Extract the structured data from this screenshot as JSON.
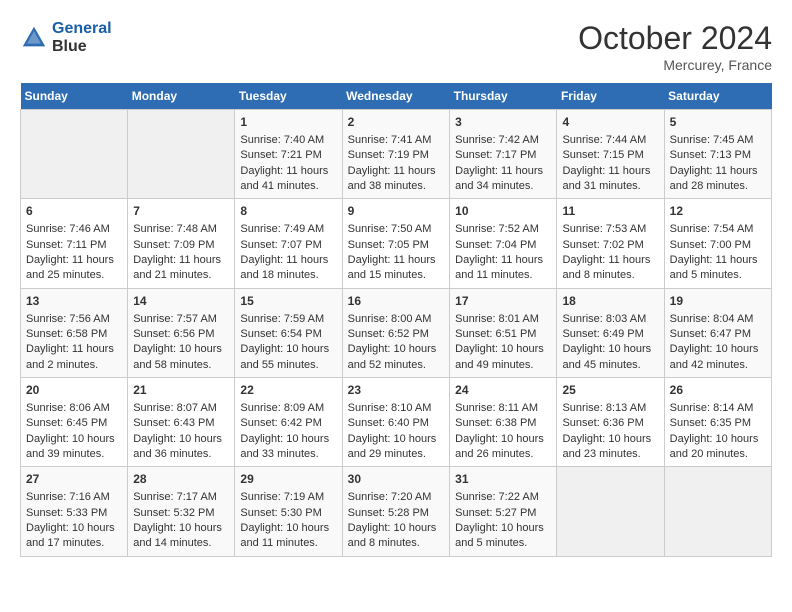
{
  "header": {
    "logo_line1": "General",
    "logo_line2": "Blue",
    "month": "October 2024",
    "location": "Mercurey, France"
  },
  "weekdays": [
    "Sunday",
    "Monday",
    "Tuesday",
    "Wednesday",
    "Thursday",
    "Friday",
    "Saturday"
  ],
  "weeks": [
    [
      {
        "day": "",
        "data": ""
      },
      {
        "day": "",
        "data": ""
      },
      {
        "day": "1",
        "data": "Sunrise: 7:40 AM\nSunset: 7:21 PM\nDaylight: 11 hours and 41 minutes."
      },
      {
        "day": "2",
        "data": "Sunrise: 7:41 AM\nSunset: 7:19 PM\nDaylight: 11 hours and 38 minutes."
      },
      {
        "day": "3",
        "data": "Sunrise: 7:42 AM\nSunset: 7:17 PM\nDaylight: 11 hours and 34 minutes."
      },
      {
        "day": "4",
        "data": "Sunrise: 7:44 AM\nSunset: 7:15 PM\nDaylight: 11 hours and 31 minutes."
      },
      {
        "day": "5",
        "data": "Sunrise: 7:45 AM\nSunset: 7:13 PM\nDaylight: 11 hours and 28 minutes."
      }
    ],
    [
      {
        "day": "6",
        "data": "Sunrise: 7:46 AM\nSunset: 7:11 PM\nDaylight: 11 hours and 25 minutes."
      },
      {
        "day": "7",
        "data": "Sunrise: 7:48 AM\nSunset: 7:09 PM\nDaylight: 11 hours and 21 minutes."
      },
      {
        "day": "8",
        "data": "Sunrise: 7:49 AM\nSunset: 7:07 PM\nDaylight: 11 hours and 18 minutes."
      },
      {
        "day": "9",
        "data": "Sunrise: 7:50 AM\nSunset: 7:05 PM\nDaylight: 11 hours and 15 minutes."
      },
      {
        "day": "10",
        "data": "Sunrise: 7:52 AM\nSunset: 7:04 PM\nDaylight: 11 hours and 11 minutes."
      },
      {
        "day": "11",
        "data": "Sunrise: 7:53 AM\nSunset: 7:02 PM\nDaylight: 11 hours and 8 minutes."
      },
      {
        "day": "12",
        "data": "Sunrise: 7:54 AM\nSunset: 7:00 PM\nDaylight: 11 hours and 5 minutes."
      }
    ],
    [
      {
        "day": "13",
        "data": "Sunrise: 7:56 AM\nSunset: 6:58 PM\nDaylight: 11 hours and 2 minutes."
      },
      {
        "day": "14",
        "data": "Sunrise: 7:57 AM\nSunset: 6:56 PM\nDaylight: 10 hours and 58 minutes."
      },
      {
        "day": "15",
        "data": "Sunrise: 7:59 AM\nSunset: 6:54 PM\nDaylight: 10 hours and 55 minutes."
      },
      {
        "day": "16",
        "data": "Sunrise: 8:00 AM\nSunset: 6:52 PM\nDaylight: 10 hours and 52 minutes."
      },
      {
        "day": "17",
        "data": "Sunrise: 8:01 AM\nSunset: 6:51 PM\nDaylight: 10 hours and 49 minutes."
      },
      {
        "day": "18",
        "data": "Sunrise: 8:03 AM\nSunset: 6:49 PM\nDaylight: 10 hours and 45 minutes."
      },
      {
        "day": "19",
        "data": "Sunrise: 8:04 AM\nSunset: 6:47 PM\nDaylight: 10 hours and 42 minutes."
      }
    ],
    [
      {
        "day": "20",
        "data": "Sunrise: 8:06 AM\nSunset: 6:45 PM\nDaylight: 10 hours and 39 minutes."
      },
      {
        "day": "21",
        "data": "Sunrise: 8:07 AM\nSunset: 6:43 PM\nDaylight: 10 hours and 36 minutes."
      },
      {
        "day": "22",
        "data": "Sunrise: 8:09 AM\nSunset: 6:42 PM\nDaylight: 10 hours and 33 minutes."
      },
      {
        "day": "23",
        "data": "Sunrise: 8:10 AM\nSunset: 6:40 PM\nDaylight: 10 hours and 29 minutes."
      },
      {
        "day": "24",
        "data": "Sunrise: 8:11 AM\nSunset: 6:38 PM\nDaylight: 10 hours and 26 minutes."
      },
      {
        "day": "25",
        "data": "Sunrise: 8:13 AM\nSunset: 6:36 PM\nDaylight: 10 hours and 23 minutes."
      },
      {
        "day": "26",
        "data": "Sunrise: 8:14 AM\nSunset: 6:35 PM\nDaylight: 10 hours and 20 minutes."
      }
    ],
    [
      {
        "day": "27",
        "data": "Sunrise: 7:16 AM\nSunset: 5:33 PM\nDaylight: 10 hours and 17 minutes."
      },
      {
        "day": "28",
        "data": "Sunrise: 7:17 AM\nSunset: 5:32 PM\nDaylight: 10 hours and 14 minutes."
      },
      {
        "day": "29",
        "data": "Sunrise: 7:19 AM\nSunset: 5:30 PM\nDaylight: 10 hours and 11 minutes."
      },
      {
        "day": "30",
        "data": "Sunrise: 7:20 AM\nSunset: 5:28 PM\nDaylight: 10 hours and 8 minutes."
      },
      {
        "day": "31",
        "data": "Sunrise: 7:22 AM\nSunset: 5:27 PM\nDaylight: 10 hours and 5 minutes."
      },
      {
        "day": "",
        "data": ""
      },
      {
        "day": "",
        "data": ""
      }
    ]
  ]
}
